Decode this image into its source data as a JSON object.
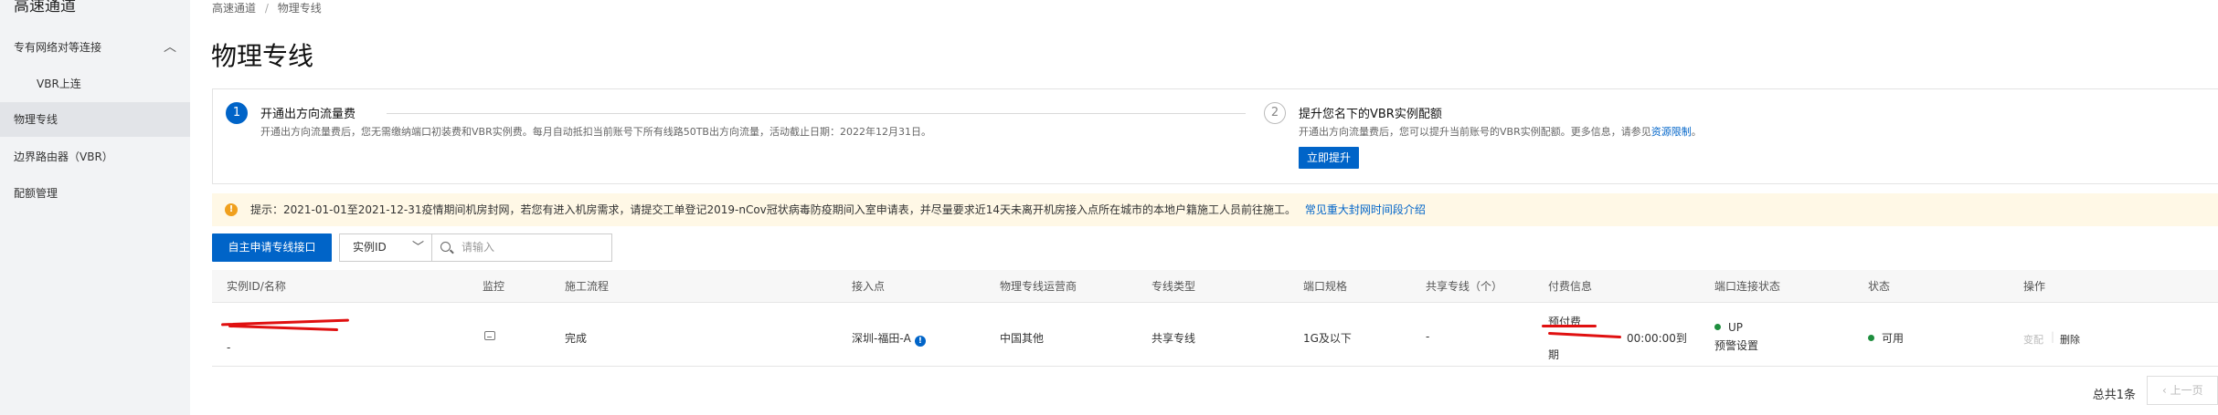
{
  "sidebar": {
    "title": "高速通道",
    "items": [
      {
        "label": "专有网络对等连接",
        "expanded": true
      },
      {
        "label": "VBR上连"
      },
      {
        "label": "物理专线",
        "active": true
      },
      {
        "label": "边界路由器（VBR）"
      },
      {
        "label": "配额管理"
      }
    ]
  },
  "breadcrumb": {
    "root": "高速通道",
    "sep": "/",
    "current": "物理专线"
  },
  "page_title": "物理专线",
  "steps": [
    {
      "num": "1",
      "title": "开通出方向流量费",
      "desc": "开通出方向流量费后，您无需缴纳端口初装费和VBR实例费。每月自动抵扣当前账号下所有线路50TB出方向流量，活动截止日期：2022年12月31日。"
    },
    {
      "num": "2",
      "title": "提升您名下的VBR实例配额",
      "desc": "开通出方向流量费后，您可以提升当前账号的VBR实例配额。更多信息，请参见",
      "link": "资源限制",
      "desc_end": "。",
      "button": "立即提升"
    }
  ],
  "notice": {
    "icon": "warning-icon",
    "text": "提示：2021-01-01至2021-12-31疫情期间机房封网，若您有进入机房需求，请提交工单登记2019-nCov冠状病毒防疫期间入室申请表，并尽量要求近14天未离开机房接入点所在城市的本地户籍施工人员前往施工。",
    "link": "常见重大封网时间段介绍"
  },
  "toolbar": {
    "apply_button": "自主申请专线接口",
    "select_value": "实例ID",
    "search_placeholder": "请输入"
  },
  "table": {
    "columns": [
      "实例ID/名称",
      "监控",
      "施工流程",
      "接入点",
      "物理专线运营商",
      "专线类型",
      "端口规格",
      "共享专线（个）",
      "付费信息",
      "端口连接状态",
      "状态",
      "操作"
    ],
    "rows": [
      {
        "id_name": "-",
        "process": "完成",
        "access_point": "深圳-福田-A",
        "operator": "中国其他",
        "line_type": "共享专线",
        "port_spec": "1G及以下",
        "shared": "-",
        "billing": "预付费",
        "billing_time": "00:00:00到",
        "billing_end": "期",
        "port_status": "UP",
        "port_link": "预警设置",
        "status": "可用",
        "action_change": "变配",
        "action_delete": "删除"
      }
    ]
  },
  "pager": {
    "total": "总共1条",
    "prev": "上一页"
  },
  "colors": {
    "primary": "#0064c8",
    "ok": "#1e8e3e",
    "warning": "#f0a01e",
    "notice_bg": "#fff8e6",
    "redaction": "#e01010"
  }
}
